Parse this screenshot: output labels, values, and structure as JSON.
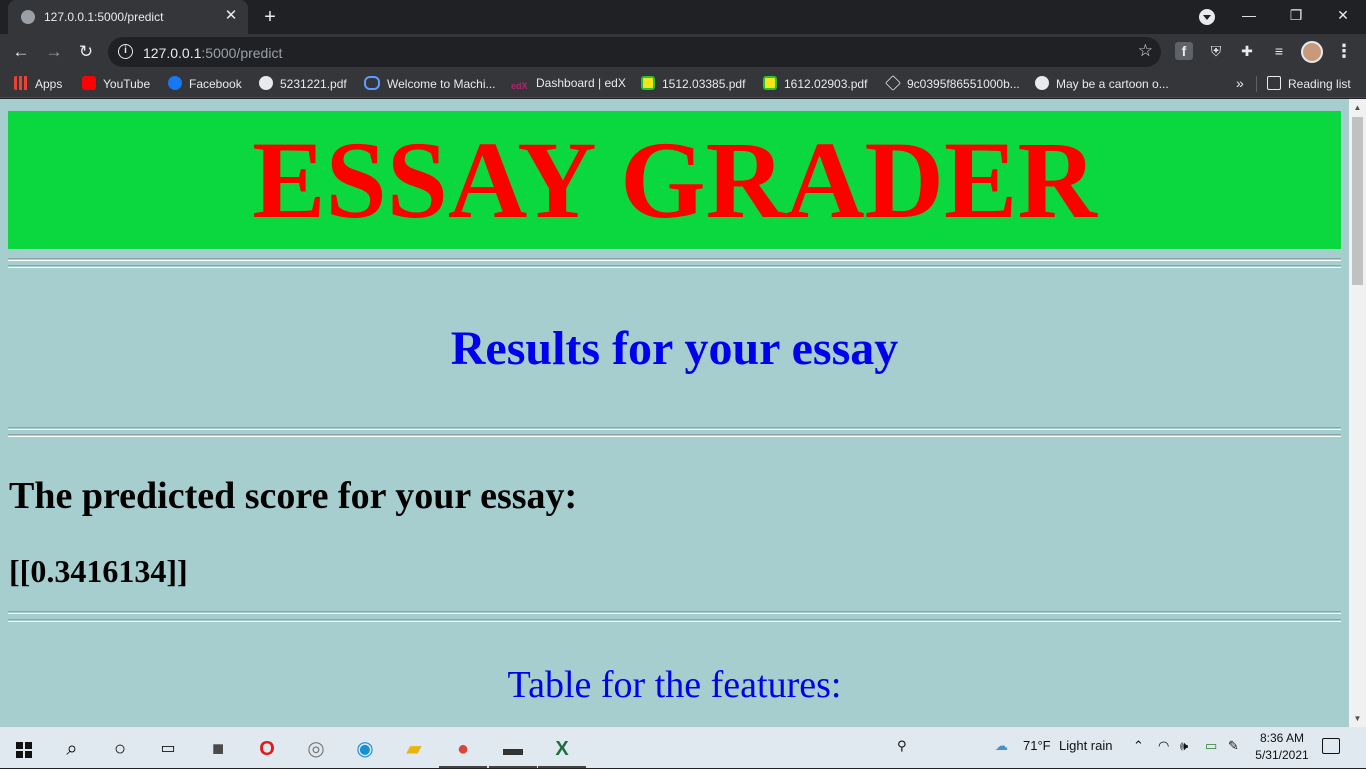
{
  "browser": {
    "tab_title": "127.0.0.1:5000/predict",
    "tab_close": "✕",
    "new_tab": "+",
    "url_host": "127.0.0.1",
    "url_rest": ":5000/predict",
    "window": {
      "minimize": "—",
      "restore": "❐",
      "close": "✕"
    },
    "nav": {
      "back": "←",
      "forward": "→",
      "reload": "↻"
    },
    "extensions": {
      "facebook": "f",
      "shield": "⛨",
      "puzzle": "✚",
      "media": "≡",
      "menu": "⋮"
    }
  },
  "bookmarks": {
    "items": [
      {
        "label": "Apps"
      },
      {
        "label": "YouTube"
      },
      {
        "label": "Facebook"
      },
      {
        "label": "5231221.pdf"
      },
      {
        "label": "Welcome to Machi..."
      },
      {
        "label": "Dashboard | edX"
      },
      {
        "label": "1512.03385.pdf"
      },
      {
        "label": "1612.02903.pdf"
      },
      {
        "label": "9c0395f86551000b..."
      },
      {
        "label": "May be a cartoon o..."
      }
    ],
    "more": "»",
    "reading_list": "Reading list"
  },
  "page": {
    "banner_title": "ESSAY GRADER",
    "results_heading": "Results for your essay",
    "score_label": "The predicted score for your essay:",
    "score_value": "[[0.3416134]]",
    "table_heading": "Table for the features:",
    "colors": {
      "background": "#a6cece",
      "banner": "#0bd83e",
      "banner_text": "#ff0000",
      "link_blue": "#0000ee"
    }
  },
  "taskbar": {
    "weather_temp": "71°F",
    "weather_desc": "Light rain",
    "time": "8:36 AM",
    "date": "5/31/2021"
  }
}
